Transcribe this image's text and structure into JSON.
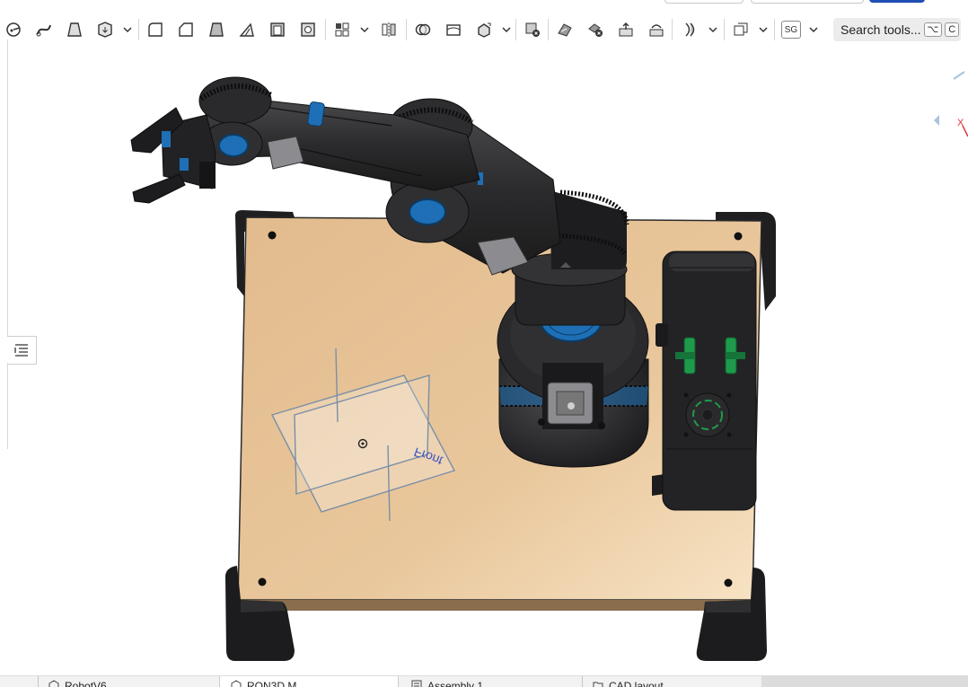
{
  "toolbar": {
    "search_label": "Search tools...",
    "search_shortcut_1": "⌥",
    "search_shortcut_2": "C",
    "sg_label": "SG",
    "icons": [
      "sketch-arc-icon",
      "sweep-icon",
      "loft-icon",
      "thicken-icon",
      "fillet-icon",
      "chamfer-icon",
      "draft-icon",
      "rib-icon",
      "shell-icon",
      "hole-icon",
      "pattern-icon",
      "mirror-icon",
      "boolean-icon",
      "split-icon",
      "transform-icon",
      "delete-part-icon",
      "modify-fillet-icon",
      "delete-face-icon",
      "move-face-icon",
      "replace-face-icon",
      "offset-surface-icon",
      "sheet-metal-icon",
      "sg-icon"
    ]
  },
  "viewport": {
    "plane_label": "Front",
    "view_cube_axis": "X"
  },
  "tabs": [
    {
      "label": "RobotV6",
      "icon": "part-studio-icon"
    },
    {
      "label": "RON3D M...",
      "icon": "part-studio-icon",
      "active": true
    },
    {
      "label": "Assembly 1",
      "icon": "assembly-icon"
    },
    {
      "label": "CAD layout",
      "icon": "folder-icon"
    }
  ],
  "colors": {
    "board": "#e6c497",
    "robot_body": "#2b2b2d",
    "accent_blue": "#1e6fb5",
    "accent_green": "#1f9a4c",
    "primary_button": "#1f4fb4"
  }
}
